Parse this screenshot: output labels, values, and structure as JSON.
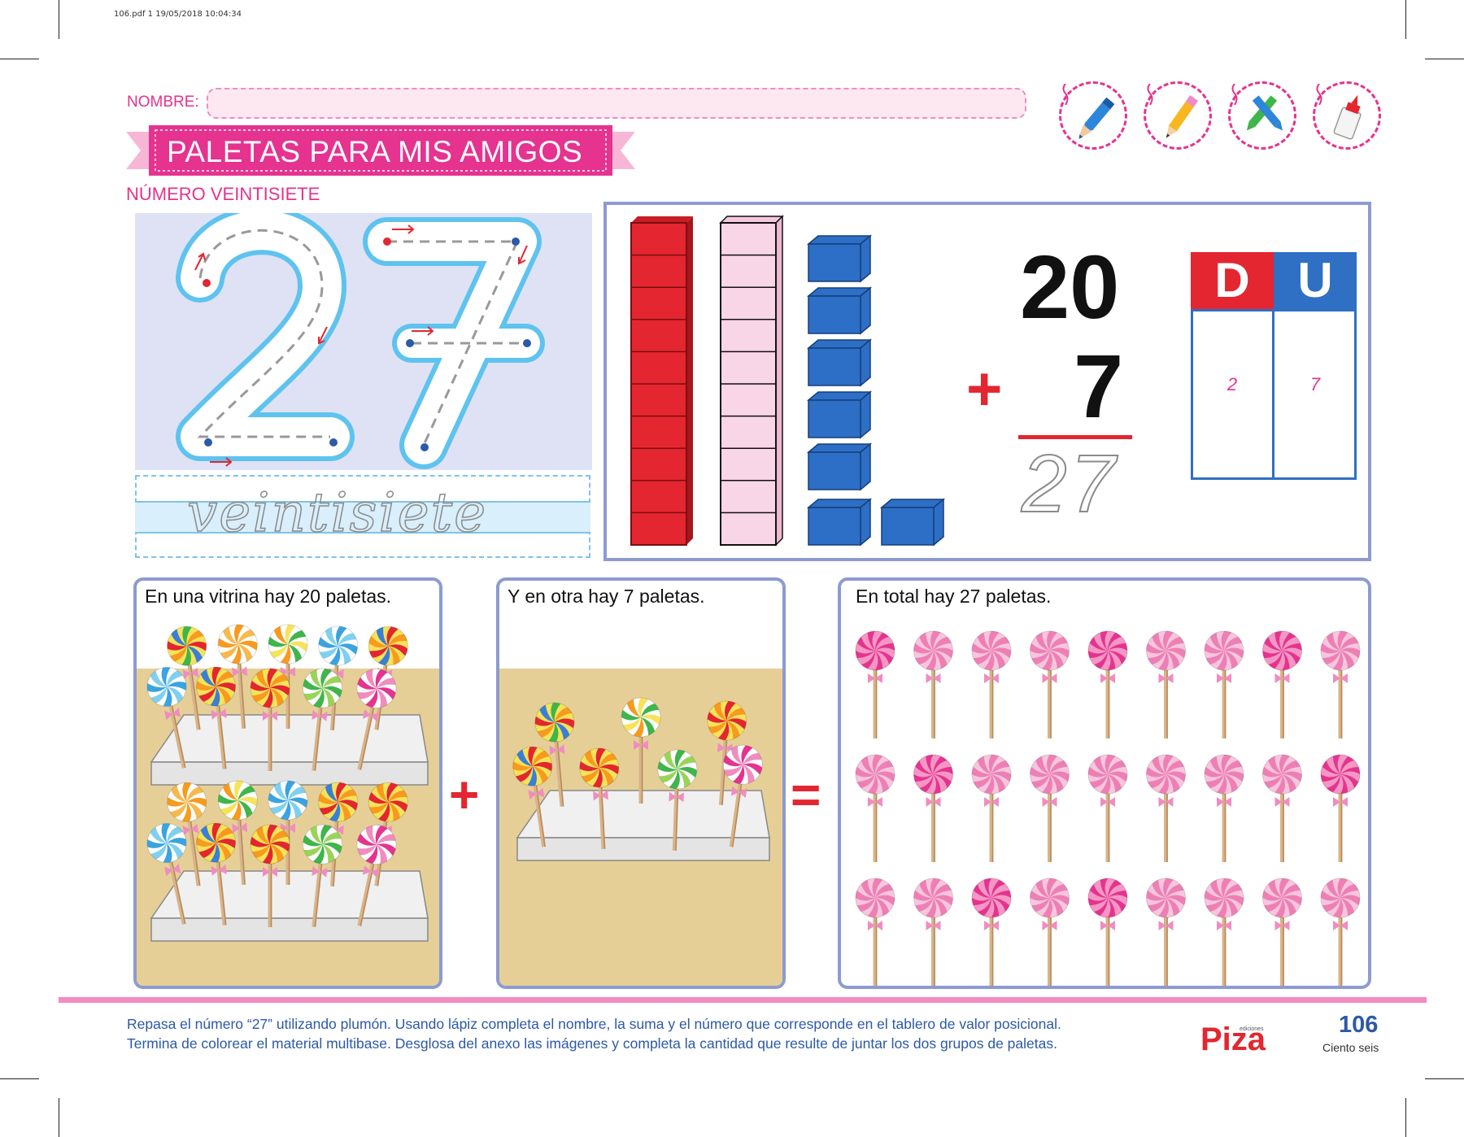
{
  "print_meta": "106.pdf   1   19/05/2018   10:04:34",
  "nombre_label": "NOMBRE:",
  "tools": [
    {
      "icon": "marker-icon"
    },
    {
      "icon": "pencil-icon"
    },
    {
      "icon": "crayons-icon"
    },
    {
      "icon": "glue-icon"
    }
  ],
  "title": "PALETAS PARA MIS AMIGOS",
  "subtitle": "NÚMERO VEINTISIETE",
  "trace": {
    "number": "27",
    "word": "veintisiete"
  },
  "sum": {
    "tens": "20",
    "units": "7",
    "plus": "+",
    "result": "27"
  },
  "place_value": {
    "d_label": "D",
    "u_label": "U",
    "d_value": "2",
    "u_value": "7"
  },
  "stories": {
    "first": "En una vitrina hay 20 paletas.",
    "second": "Y en otra hay 7 paletas.",
    "total": "En total hay 27 paletas.",
    "plus": "+",
    "equals": "="
  },
  "colors": {
    "pink": "#e5338f",
    "blue": "#2c59a8",
    "red": "#e3262f",
    "frame": "#8c9bd0"
  },
  "footer": {
    "line1": "Repasa el número “27” utilizando plumón. Usando lápiz completa el nombre, la suma y el número que corresponde en el tablero de valor posicional.",
    "line2": "Termina de colorear el material multibase. Desglosa del anexo las imágenes y completa la cantidad que resulte de juntar los dos grupos de paletas."
  },
  "brand": "Piza",
  "brand_small": "ediciones",
  "page_number": "106",
  "page_words": "Ciento seis"
}
